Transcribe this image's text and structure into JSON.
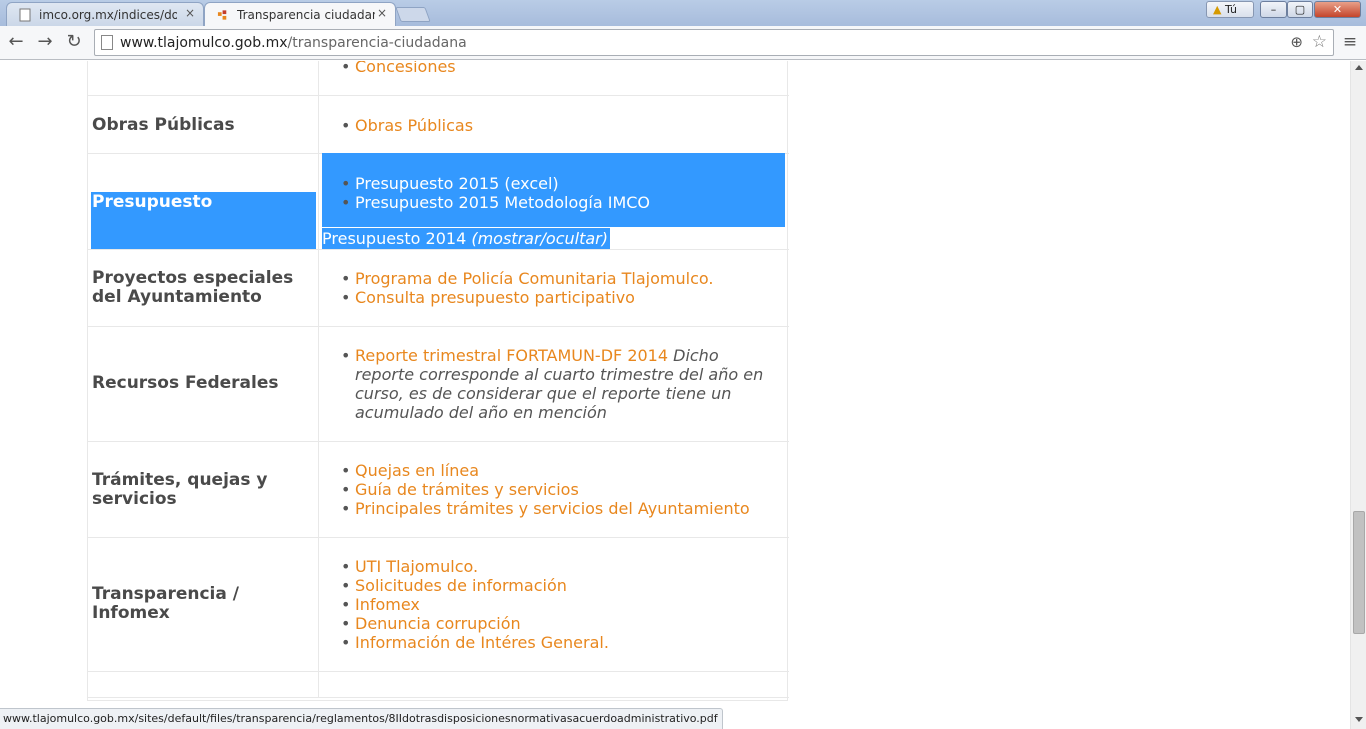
{
  "browser": {
    "tabs": [
      {
        "title": "imco.org.mx/indices/docu",
        "close": "×"
      },
      {
        "title": "Transparencia ciudadana",
        "close": "×"
      }
    ],
    "profile_label": "Tú",
    "url_host": "www.tlajomulco.gob.mx",
    "url_path": "/transparencia-ciudadana",
    "status_url": "www.tlajomulco.gob.mx/sites/default/files/transparencia/reglamentos/8IIdotrasdisposicionesnormativasacuerdoadministrativo.pdf"
  },
  "table": {
    "concesiones": [
      "Concesiones"
    ],
    "obras": {
      "label": "Obras Públicas",
      "links": [
        "Obras Públicas"
      ]
    },
    "presupuesto": {
      "label": "Presupuesto",
      "links": [
        "Presupuesto 2015 (excel)",
        "Presupuesto 2015 Metodología IMCO"
      ],
      "toggle_prefix": "Presupuesto 2014 ",
      "toggle_link": "(mostrar/ocultar)"
    },
    "proyectos": {
      "label": "Proyectos especiales del Ayuntamiento",
      "links": [
        "Programa de Policía Comunitaria Tlajomulco.",
        "Consulta presupuesto participativo"
      ]
    },
    "recursos": {
      "label": "Recursos Federales",
      "link": "Reporte trimestral FORTAMUN-DF 2014",
      "note": " Dicho reporte corresponde al cuarto trimestre del año en curso, es de considerar que el reporte tiene un acumulado del año en mención"
    },
    "tramites": {
      "label": "Trámites, quejas y servicios",
      "links": [
        "Quejas en línea",
        "Guía de trámites y servicios",
        "Principales trámites y servicios del Ayuntamiento"
      ]
    },
    "transparencia": {
      "label": "Transparencia / Infomex",
      "links": [
        "UTI Tlajomulco.",
        "Solicitudes de información",
        "Infomex",
        "Denuncia corrupción",
        "Información de Intéres General."
      ]
    }
  },
  "colors": {
    "link": "#e8871e",
    "selection": "#3399ff",
    "label": "#4a4a4a"
  }
}
